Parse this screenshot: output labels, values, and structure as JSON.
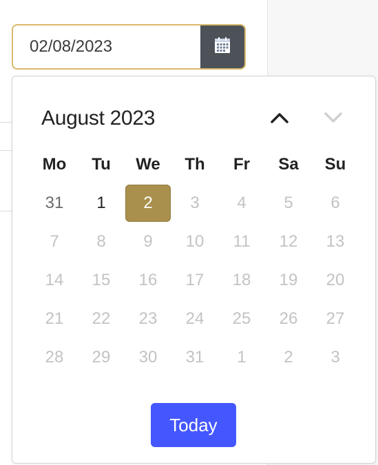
{
  "date_field": {
    "value": "02/08/2023",
    "button_icon": "calendar-icon"
  },
  "calendar": {
    "title": "August 2023",
    "prev_icon": "chevron-up-icon",
    "next_icon": "chevron-down-icon",
    "weekdays": [
      "Mo",
      "Tu",
      "We",
      "Th",
      "Fr",
      "Sa",
      "Su"
    ],
    "weeks": [
      [
        "31",
        "1",
        "2",
        "3",
        "4",
        "5",
        "6"
      ],
      [
        "7",
        "8",
        "9",
        "10",
        "11",
        "12",
        "13"
      ],
      [
        "14",
        "15",
        "16",
        "17",
        "18",
        "19",
        "20"
      ],
      [
        "21",
        "22",
        "23",
        "24",
        "25",
        "26",
        "27"
      ],
      [
        "28",
        "29",
        "30",
        "31",
        "1",
        "2",
        "3"
      ]
    ],
    "selected_day": "2",
    "today_label": "Today"
  },
  "colors": {
    "accent_gold": "#a9904c",
    "input_border": "#d9b96a",
    "today_button": "#4457ff",
    "icon_button_bg": "#4d5259"
  }
}
